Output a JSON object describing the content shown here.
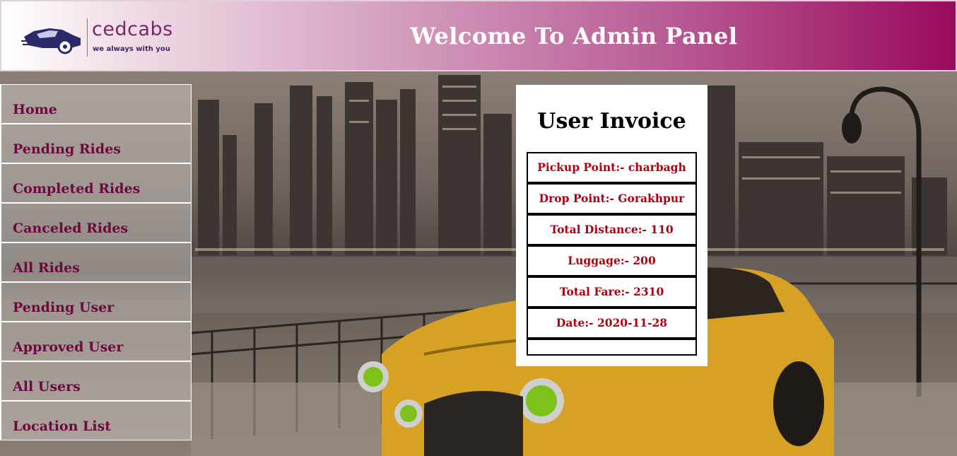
{
  "header": {
    "brand_name": "cedcabs",
    "brand_tagline": "we always with you",
    "title": "Welcome To Admin Panel"
  },
  "sidebar": {
    "items": [
      {
        "label": "Home"
      },
      {
        "label": "Pending Rides"
      },
      {
        "label": "Completed Rides"
      },
      {
        "label": "Canceled Rides"
      },
      {
        "label": "All Rides"
      },
      {
        "label": "Pending User"
      },
      {
        "label": "Approved User"
      },
      {
        "label": "All Users"
      },
      {
        "label": "Location List"
      }
    ]
  },
  "invoice": {
    "title": "User Invoice",
    "rows": [
      {
        "text": "Pickup Point:- charbagh"
      },
      {
        "text": "Drop Point:- Gorakhpur"
      },
      {
        "text": "Total Distance:- 110"
      },
      {
        "text": "Luggage:- 200"
      },
      {
        "text": "Total Fare:- 2310"
      },
      {
        "text": "Date:- 2020-11-28"
      },
      {
        "text": ""
      }
    ]
  },
  "colors": {
    "nav_text": "#6b0a3e",
    "invoice_text": "#b00010",
    "header_gradient_end": "#9a0a5c"
  }
}
